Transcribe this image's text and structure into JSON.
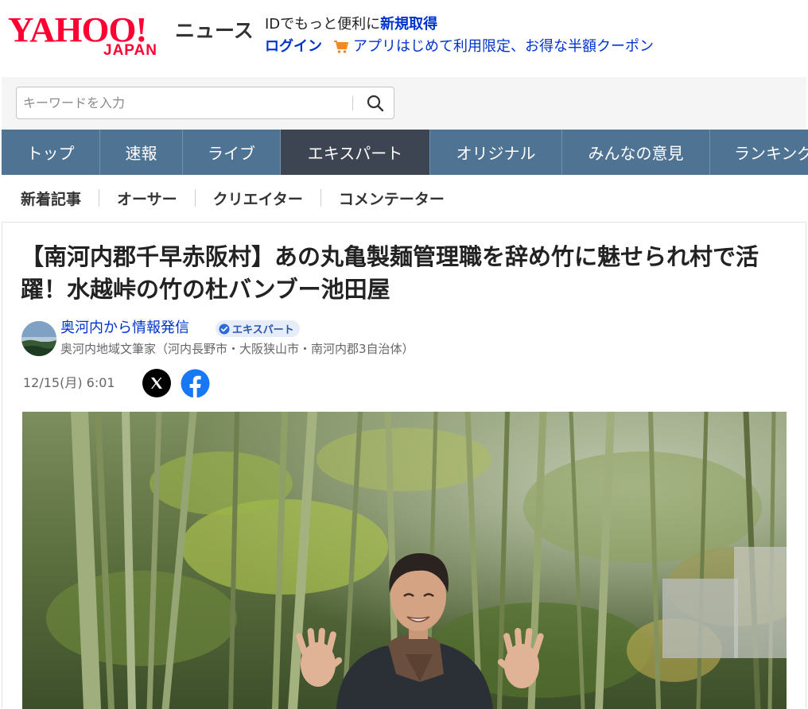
{
  "brand": {
    "logo_main": "YAHOO!",
    "logo_sub": "JAPAN",
    "service": "ニュース"
  },
  "promo": {
    "line1_prefix": "IDでもっと便利に",
    "line1_highlight": "新規取得",
    "login_label": "ログイン",
    "coupon_text": "アプリはじめて利用限定、お得な半額クーポン"
  },
  "search": {
    "placeholder": "キーワードを入力",
    "value": ""
  },
  "nav": {
    "tabs": [
      {
        "label": "トップ",
        "active": false
      },
      {
        "label": "速報",
        "active": false
      },
      {
        "label": "ライブ",
        "active": false
      },
      {
        "label": "エキスパート",
        "active": true
      },
      {
        "label": "オリジナル",
        "active": false
      },
      {
        "label": "みんなの意見",
        "active": false
      },
      {
        "label": "ランキング",
        "active": false
      }
    ]
  },
  "subnav": {
    "items": [
      "新着記事",
      "オーサー",
      "クリエイター",
      "コメンテーター"
    ]
  },
  "article": {
    "title": "【南河内郡千早赤阪村】あの丸亀製麺管理職を辞め竹に魅せられ村で活躍！水越峠の竹の杜バンブー池田屋",
    "author_name": "奥河内から情報発信",
    "author_badge": "エキスパート",
    "author_desc": "奥河内地域文筆家（河内長野市・大阪狭山市・南河内郡3自治体）",
    "date": "12/15(月) 6:01"
  },
  "colors": {
    "brand_red": "#ff0033",
    "link_blue": "#0033cc",
    "nav_bg": "#4f7393",
    "nav_active": "#3d4452",
    "facebook_blue": "#1877f2"
  },
  "icons": {
    "search": "search-icon",
    "cart": "cart-icon",
    "badge": "verified-check-icon",
    "x": "x-logo-icon",
    "facebook": "facebook-icon"
  }
}
